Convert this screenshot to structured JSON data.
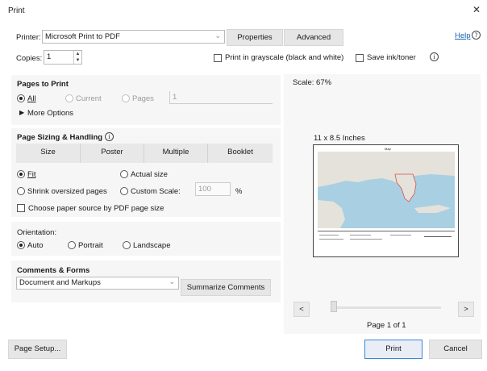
{
  "window": {
    "title": "Print"
  },
  "header": {
    "printer_label": "Printer:",
    "printer_value": "Microsoft Print to PDF",
    "properties_label": "Properties",
    "advanced_label": "Advanced",
    "help_label": "Help",
    "copies_label": "Copies:",
    "copies_value": "1",
    "grayscale_label": "Print in grayscale (black and white)",
    "save_ink_label": "Save ink/toner"
  },
  "pages_to_print": {
    "title": "Pages to Print",
    "all_label": "All",
    "current_label": "Current",
    "pages_label": "Pages",
    "pages_value": "1",
    "more_options_label": "More Options",
    "selected": "All"
  },
  "sizing": {
    "title": "Page Sizing & Handling",
    "tabs": [
      "Size",
      "Poster",
      "Multiple",
      "Booklet"
    ],
    "fit_label": "Fit",
    "actual_label": "Actual size",
    "shrink_label": "Shrink oversized pages",
    "custom_label": "Custom Scale:",
    "custom_value": "100",
    "percent": "%",
    "paper_source_label": "Choose paper source by PDF page size",
    "selected": "Fit"
  },
  "orientation": {
    "title": "Orientation:",
    "auto_label": "Auto",
    "portrait_label": "Portrait",
    "landscape_label": "Landscape",
    "selected": "Auto"
  },
  "comments": {
    "title": "Comments & Forms",
    "value": "Document and Markups",
    "summarize_label": "Summarize Comments"
  },
  "preview": {
    "scale_label": "Scale: 67%",
    "paper_size_label": "11 x 8.5 Inches",
    "map_title": "Map",
    "prev_label": "<",
    "next_label": ">",
    "page_indicator": "Page 1 of 1",
    "slider_fraction": 0.0
  },
  "footer": {
    "page_setup_label": "Page Setup...",
    "print_label": "Print",
    "cancel_label": "Cancel"
  },
  "colors": {
    "accent": "#3a86d6",
    "link": "#1a5fb4",
    "map_water": "#a9cfe3",
    "map_land": "#e4e2da",
    "highlight_state": "#d9534f"
  }
}
